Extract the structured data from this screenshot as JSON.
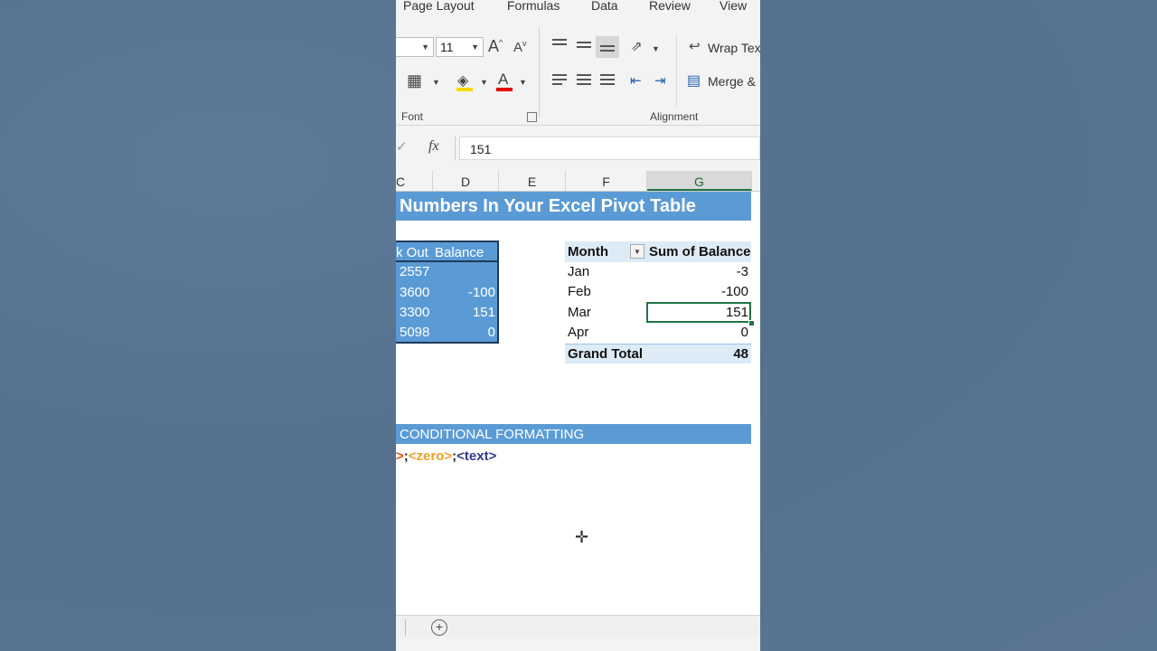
{
  "ribbon": {
    "tabs": [
      "Page Layout",
      "Formulas",
      "Data",
      "Review",
      "View"
    ],
    "font_size": "11",
    "wrap_text_label": "Wrap Text",
    "merge_label": "Merge &",
    "group_font": "Font",
    "group_alignment": "Alignment"
  },
  "formula_bar": {
    "fx": "fx",
    "value": "151"
  },
  "columns": [
    "C",
    "D",
    "E",
    "F",
    "G"
  ],
  "title": "Numbers In Your Excel Pivot Table",
  "source_table": {
    "header_left": "k Out",
    "header_right": "Balance",
    "rows": [
      {
        "left": "2557",
        "right": ""
      },
      {
        "left": "3600",
        "right": "-100"
      },
      {
        "left": "3300",
        "right": "151"
      },
      {
        "left": "5098",
        "right": "0"
      }
    ]
  },
  "pivot": {
    "col1": "Month",
    "col2": "Sum of Balance",
    "rows": [
      {
        "month": "Jan",
        "value": "-3"
      },
      {
        "month": "Feb",
        "value": "-100"
      },
      {
        "month": "Mar",
        "value": "151"
      },
      {
        "month": "Apr",
        "value": "0"
      }
    ],
    "grand_label": "Grand Total",
    "grand_value": "48"
  },
  "conditional_formatting": "CONDITIONAL FORMATTING",
  "format_parts": {
    "p1": ">",
    "sep1": ";",
    "zero": "<zero>",
    "sep2": ";",
    "text": "<text>"
  },
  "colors": {
    "accent": "#5b9bd5",
    "pivot_header": "#ddebf7",
    "zero_color": "#f0a020",
    "text_color": "#2e3a8c",
    "neg_color": "#e05010",
    "excel_green": "#217346"
  }
}
